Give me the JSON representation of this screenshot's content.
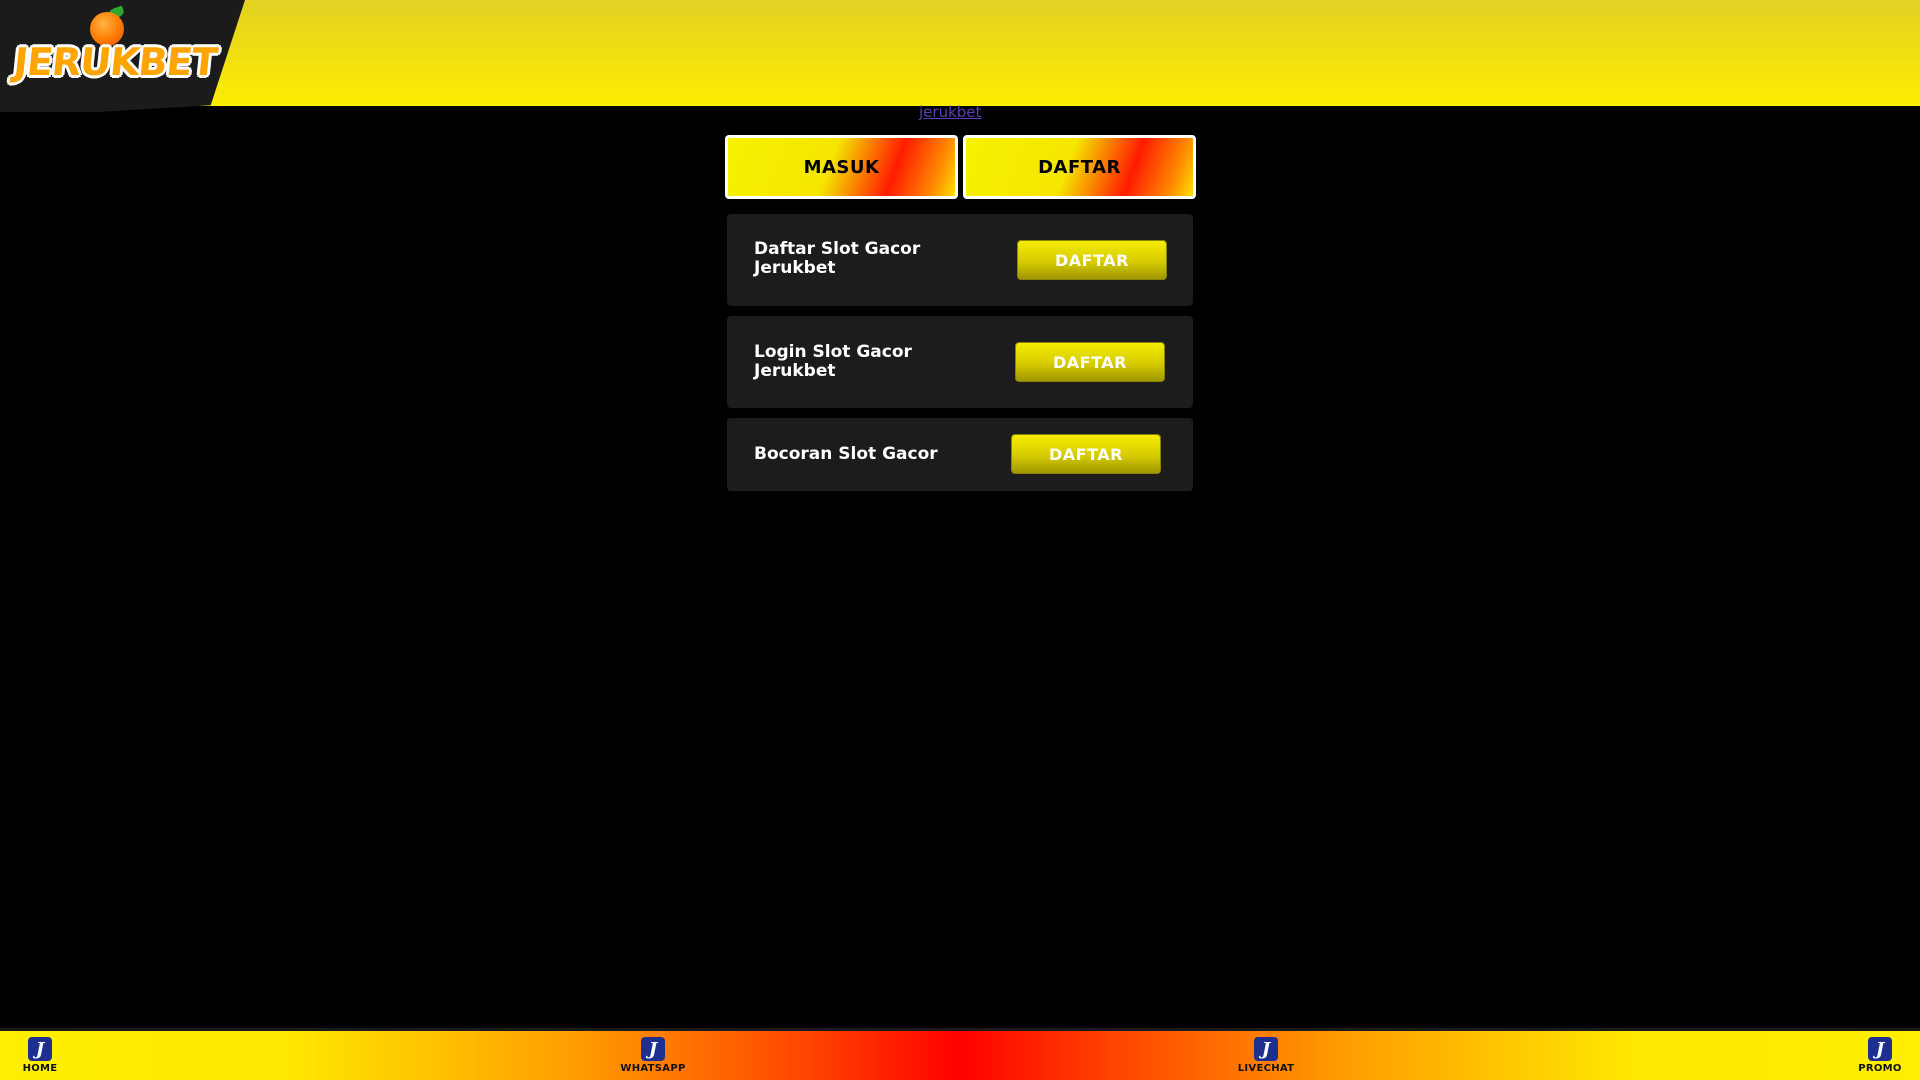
{
  "header": {
    "logo_text": "JERUKBET"
  },
  "banner_image": {
    "alt_text": "jerukbet"
  },
  "top_buttons": {
    "masuk": "MASUK",
    "daftar": "DAFTAR"
  },
  "cards": [
    {
      "title": "Daftar Slot Gacor Jerukbet",
      "button": "DAFTAR"
    },
    {
      "title": "Login Slot Gacor Jerukbet",
      "button": "DAFTAR"
    },
    {
      "title": "Bocoran Slot Gacor",
      "button": "DAFTAR"
    }
  ],
  "bottom_nav": {
    "items": [
      {
        "icon": "J",
        "label": "HOME"
      },
      {
        "icon": "J",
        "label": "WHATSAPP"
      },
      {
        "icon": "J",
        "label": "LIVECHAT"
      },
      {
        "icon": "J",
        "label": "PROMO"
      }
    ]
  },
  "colors": {
    "header_yellow": "#f2e20e",
    "background": "#000000",
    "card_bg": "#1c1c1c",
    "button_yellow": "#f4ec00",
    "accent_red": "#ff1c00",
    "nav_icon_blue": "#1f2f8f"
  }
}
